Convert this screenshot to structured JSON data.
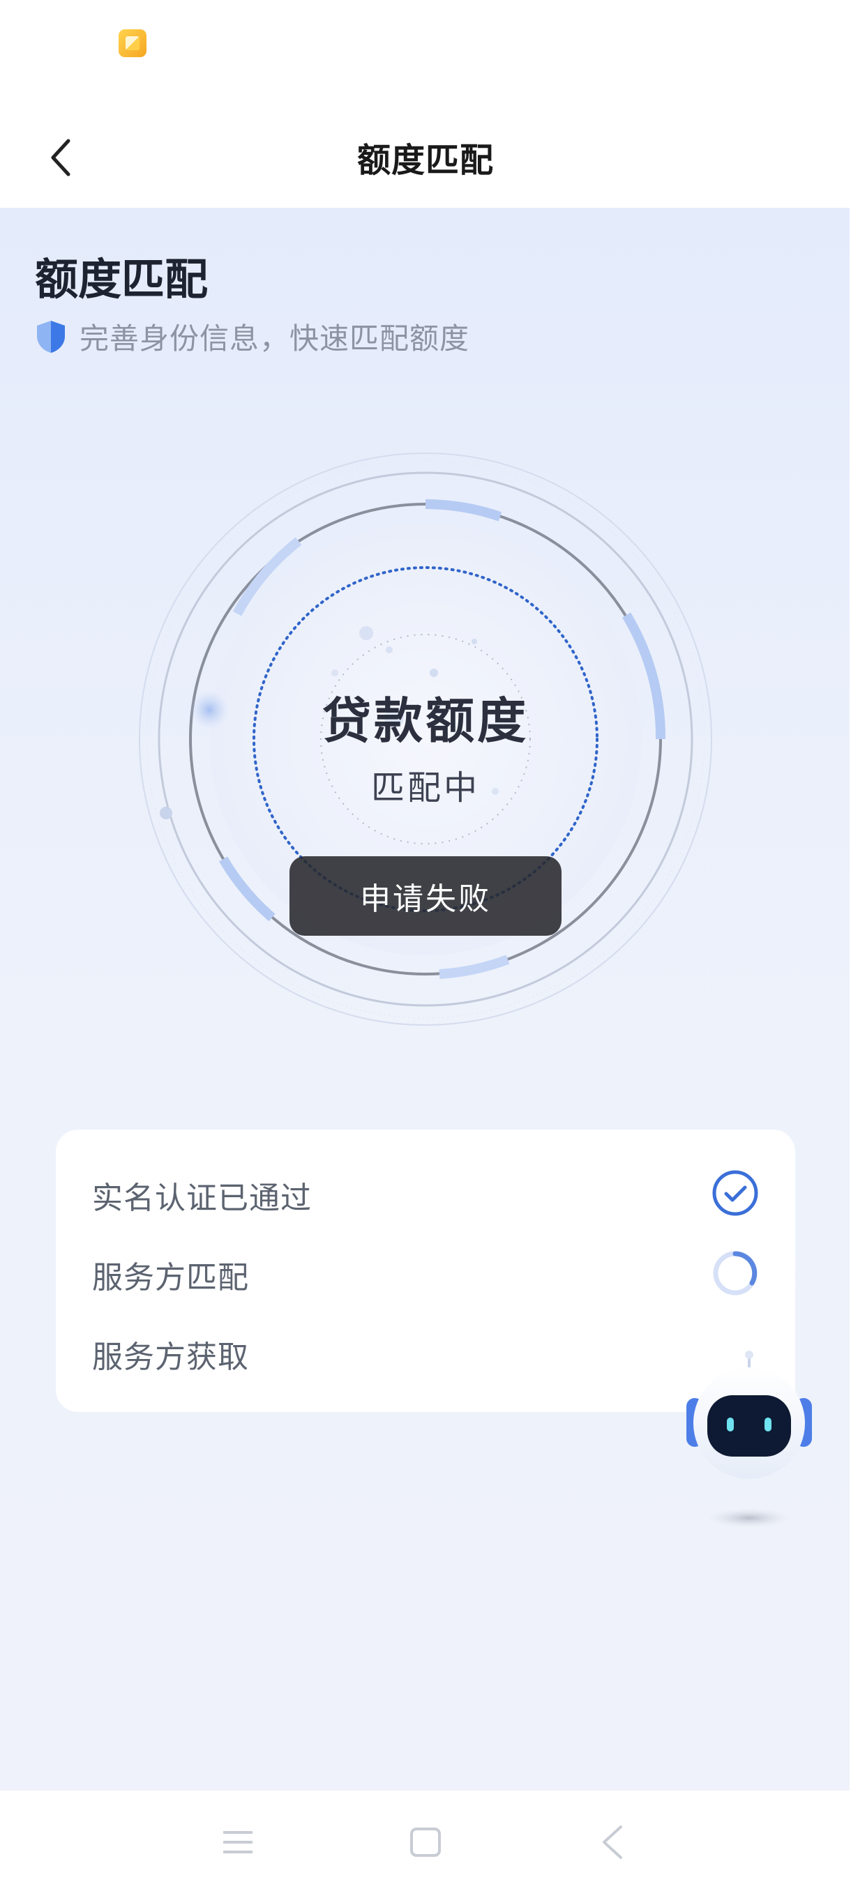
{
  "nav": {
    "title": "额度匹配"
  },
  "header": {
    "title": "额度匹配",
    "subtitle": "完善身份信息，快速匹配额度"
  },
  "match": {
    "title": "贷款额度",
    "status": "匹配中"
  },
  "toast": {
    "message": "申请失败"
  },
  "steps": [
    {
      "label": "实名认证已通过",
      "state": "done"
    },
    {
      "label": "服务方匹配",
      "state": "loading"
    },
    {
      "label": "服务方获取",
      "state": "pending"
    }
  ],
  "icons": {
    "back": "chevron-left-icon",
    "shield": "shield-icon",
    "check": "check-circle-icon",
    "spinner": "spinner-icon",
    "assistant": "robot-icon",
    "menu": "menu-icon",
    "home": "home-icon",
    "system_back": "back-icon"
  },
  "colors": {
    "accent": "#3b6fd8",
    "background": "#eaf0fb",
    "toast": "#2f3034"
  }
}
